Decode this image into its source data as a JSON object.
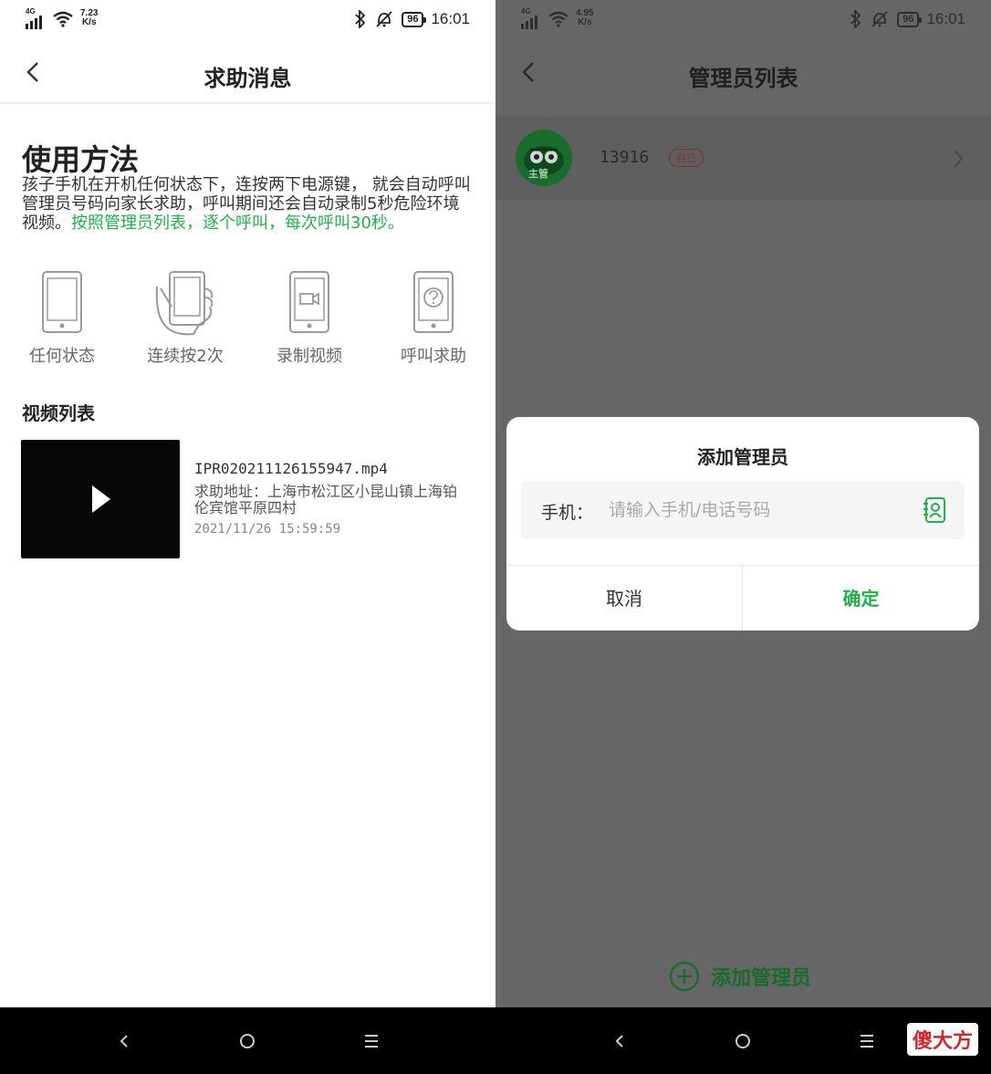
{
  "left": {
    "status": {
      "network": "4G",
      "speed_value": "7.23",
      "speed_unit": "K/s",
      "battery": "96",
      "time": "16:01"
    },
    "title": "求助消息",
    "howto": {
      "heading": "使用方法",
      "text": "孩子手机在开机任何状态下，连按两下电源键， 就会自动呼叫管理员号码向家长求助，呼叫期间还会自动录制5秒危险环境视频。",
      "highlight": "按照管理员列表，逐个呼叫，每次呼叫30秒。",
      "highlight_color": "#22b04b"
    },
    "steps": [
      {
        "label": "任何状态",
        "icon": "phone-icon"
      },
      {
        "label": "连续按2次",
        "icon": "hand-press-icon"
      },
      {
        "label": "录制视频",
        "icon": "video-record-icon"
      },
      {
        "label": "呼叫求助",
        "icon": "help-call-icon"
      }
    ],
    "video_list": {
      "heading": "视频列表",
      "items": [
        {
          "filename": "IPR020211126155947.mp4",
          "address": "求助地址：上海市松江区小昆山镇上海铂伦宾馆平原四村",
          "time": "2021/11/26 15:59:59"
        }
      ]
    }
  },
  "right": {
    "status": {
      "network": "4G",
      "speed_value": "4.95",
      "speed_unit": "K/s",
      "battery": "96",
      "time": "16:01"
    },
    "title": "管理员列表",
    "admins": [
      {
        "phone": "13916",
        "tag": "自己",
        "avatar_label": "主管"
      }
    ],
    "dialog": {
      "title": "添加管理员",
      "field_label": "手机：",
      "placeholder": "请输入手机/电话号码",
      "cancel": "取消",
      "confirm": "确定"
    },
    "add_admin_label": "添加管理员"
  },
  "watermark": "傻大方",
  "colors": {
    "accent_green": "#22b04b",
    "dark_green": "#1a6b2d",
    "overlay": "#666666"
  }
}
